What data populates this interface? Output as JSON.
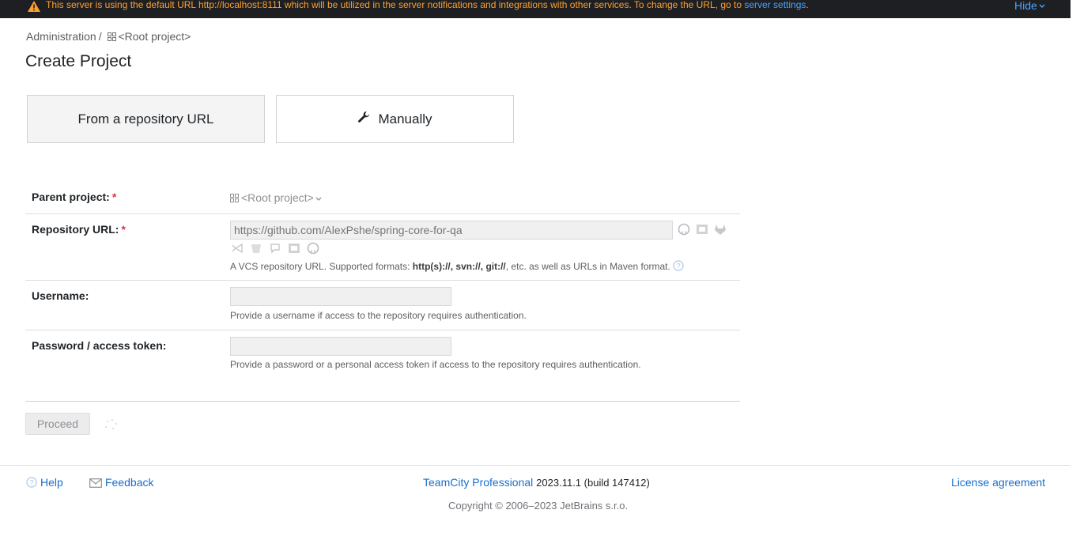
{
  "banner": {
    "message": "This server is using the default URL http://localhost:8111 which will be utilized in the server notifications and integrations with other services. To change the URL, go to",
    "link_text": "server settings",
    "message_end": ".",
    "hide_label": "Hide"
  },
  "breadcrumb": {
    "administration": "Administration",
    "separator": "/",
    "project": "<Root project>"
  },
  "page": {
    "title": "Create Project"
  },
  "tabs": [
    {
      "label": "From a repository URL",
      "active": true
    },
    {
      "label": "Manually",
      "active": false
    }
  ],
  "form": {
    "parent_project": {
      "label": "Parent project:",
      "required": "*",
      "value": "<Root project>"
    },
    "repository_url": {
      "label": "Repository URL:",
      "required": "*",
      "placeholder": "https://github.com/AlexPshe/spring-core-for-qa",
      "help_prefix": "A VCS repository URL. Supported formats:",
      "help_formats": "http(s)://, svn://, git://",
      "help_suffix": ", etc. as well as URLs in Maven format.",
      "vcs_icons": [
        "github-icon",
        "bitbucket-server-icon",
        "gitlab-icon",
        "azure-devops-icon",
        "bitbucket-icon",
        "aws-codecommit-icon",
        "space-icon",
        "github-enterprise-icon"
      ]
    },
    "username": {
      "label": "Username:",
      "value": "",
      "help": "Provide a username if access to the repository requires authentication."
    },
    "password": {
      "label": "Password / access token:",
      "value": "",
      "help": "Provide a password or a personal access token if access to the repository requires authentication."
    }
  },
  "actions": {
    "proceed_label": "Proceed"
  },
  "footer": {
    "help": "Help",
    "feedback": "Feedback",
    "product": "TeamCity Professional",
    "version": "2023.11.1 (build 147412)",
    "license": "License agreement",
    "copyright": "Copyright © 2006–2023 JetBrains s.r.o."
  },
  "colors": {
    "banner_bg": "#1d1f22",
    "banner_text": "#ff9f2e",
    "link": "#1a6fcc",
    "required": "#e0334a"
  }
}
